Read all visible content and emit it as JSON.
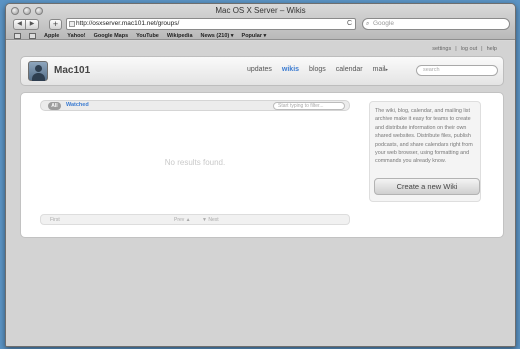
{
  "browser": {
    "window_title": "Mac OS X Server – Wikis",
    "url": "http://osxserver.mac101.net/groups/",
    "search_placeholder": "Google",
    "back_glyph": "◀",
    "forward_glyph": "▶",
    "new_tab_glyph": "+",
    "reload_glyph": "C",
    "bookmarks": [
      "Apple",
      "Yahoo!",
      "Google Maps",
      "YouTube",
      "Wikipedia",
      "News (210) ▾",
      "Popular ▾"
    ]
  },
  "site": {
    "top_links": [
      "settings",
      "log out",
      "help"
    ],
    "top_link_separator": "|",
    "name": "Mac101",
    "nav": [
      {
        "label": "updates"
      },
      {
        "label": "wikis",
        "active": true
      },
      {
        "label": "blogs"
      },
      {
        "label": "calendar"
      },
      {
        "label": "mail"
      }
    ],
    "nav_caret": "▸",
    "search_placeholder": "search"
  },
  "list": {
    "tab_all": "All",
    "tab_watched": "Watched",
    "filter_placeholder": "Start typing to filter...",
    "empty_message": "No results found.",
    "pager_first": "First",
    "pager_prev": "Prev ▲",
    "pager_next": "▼ Next"
  },
  "sidebar": {
    "description": "The wiki, blog, calendar, and mailing list archive make it easy for teams to create and distribute information on their own shared websites. Distribute files, publish podcasts, and share calendars right from your web browser, using formatting and commands you already know.",
    "create_button": "Create a new Wiki"
  }
}
